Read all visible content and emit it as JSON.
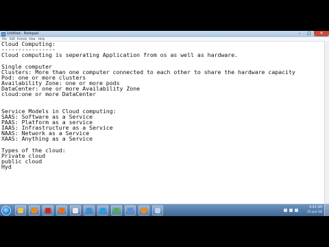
{
  "window": {
    "title": "Untitled - Notepad",
    "min": "–",
    "max": "□",
    "close": "✕"
  },
  "menu": [
    "File",
    "Edit",
    "Format",
    "View",
    "Help"
  ],
  "lines": [
    "Cloud Computing:",
    "----------------",
    "Cloud computing is seperating Application from os as well as hardware.",
    "",
    "Single computer",
    "Clusters: More than one computer connected to each other to share the hardware capacity",
    "Pod: one or more clusters",
    "Availability Zone: one or more pods",
    "DataCenter: one or more Availability Zone",
    "cloud:one or more DataCenter",
    "",
    "",
    "Service Models in Cloud computing:",
    "SAAS: Software as a Service",
    "PAAS: Platform as a service",
    "IAAS: Infrastructure as a Service",
    "NAAS: Network as a Service",
    "XAAS: Anything as a Service",
    "",
    "Types of the cloud:",
    "Private cloud",
    "public cloud",
    "Hyd"
  ],
  "taskbar": {
    "icons": [
      {
        "name": "explorer-icon",
        "color": "#f0c24a"
      },
      {
        "name": "media-player-icon",
        "color": "#e88a1a"
      },
      {
        "name": "opera-icon",
        "color": "#d2261e"
      },
      {
        "name": "firefox-icon",
        "color": "#e46f1d"
      },
      {
        "name": "gmail-icon",
        "color": "#e8e8e8"
      },
      {
        "name": "ie-icon",
        "color": "#3b8ed8"
      },
      {
        "name": "skype-icon",
        "color": "#1fa0e0"
      },
      {
        "name": "chrome-icon",
        "color": "#4fae4a"
      },
      {
        "name": "folder-icon",
        "color": "#5a8fd4"
      },
      {
        "name": "vlc-icon",
        "color": "#f08a1a"
      },
      {
        "name": "notepad-icon",
        "color": "#b9d3ef"
      }
    ],
    "clock_time": "6:45 AM",
    "clock_date": "15-Jun-18"
  }
}
